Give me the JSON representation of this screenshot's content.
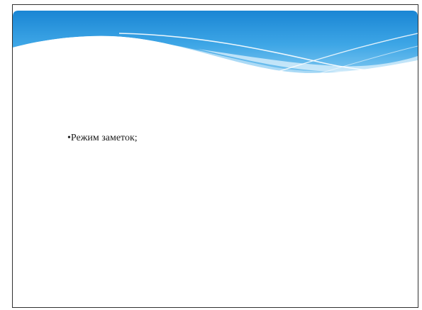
{
  "slide": {
    "bullet_text": "•Режим заметок;"
  },
  "colors": {
    "header_top": "#1c8ad6",
    "header_mid": "#4fb0ea",
    "header_light": "#bfe3f7",
    "background": "#ffffff",
    "border": "#303030",
    "text": "#1a1a1a"
  }
}
